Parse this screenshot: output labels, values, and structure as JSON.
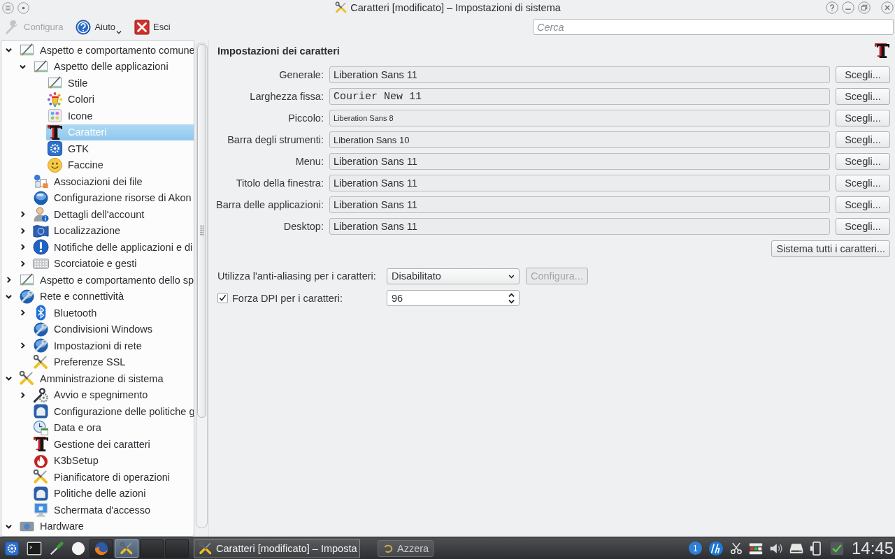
{
  "window": {
    "title": "Caratteri [modificato] – Impostazioni di sistema"
  },
  "toolbar": {
    "buttons": [
      {
        "label": "Configura",
        "kind": "configure",
        "disabled": true
      },
      {
        "label": "Aiuto",
        "kind": "help",
        "disabled": false
      },
      {
        "label": "Esci",
        "kind": "quit",
        "disabled": false
      }
    ]
  },
  "search": {
    "placeholder": "Cerca"
  },
  "sidebar": {
    "items": [
      {
        "label": "Aspetto e comportamento comune",
        "expanded": true,
        "selected": false,
        "children": [
          {
            "label": "Aspetto delle applicazioni",
            "expanded": true,
            "selected": false,
            "children": [
              {
                "label": "Stile",
                "selected": false
              },
              {
                "label": "Colori",
                "selected": false
              },
              {
                "label": "Icone",
                "selected": false
              },
              {
                "label": "Caratteri",
                "selected": true
              },
              {
                "label": "GTK",
                "selected": false
              },
              {
                "label": "Faccine",
                "selected": false
              }
            ]
          },
          {
            "label": "Associazioni dei file",
            "selected": false
          },
          {
            "label": "Configurazione risorse di Akon",
            "selected": false
          },
          {
            "label": "Dettagli dell'account",
            "expanded": false,
            "selected": false
          },
          {
            "label": "Localizzazione",
            "expanded": false,
            "selected": false
          },
          {
            "label": "Notifiche delle applicazioni e di",
            "expanded": false,
            "selected": false
          },
          {
            "label": "Scorciatoie e gesti",
            "expanded": false,
            "selected": false
          }
        ]
      },
      {
        "label": "Aspetto e comportamento dello sp",
        "expanded": false,
        "selected": false
      },
      {
        "label": "Rete e connettività",
        "expanded": true,
        "selected": false,
        "children": [
          {
            "label": "Bluetooth",
            "expanded": false,
            "selected": false
          },
          {
            "label": "Condivisioni Windows",
            "selected": false
          },
          {
            "label": "Impostazioni di rete",
            "expanded": false,
            "selected": false
          },
          {
            "label": "Preferenze SSL",
            "selected": false
          }
        ]
      },
      {
        "label": "Amministrazione di sistema",
        "expanded": true,
        "selected": false,
        "children": [
          {
            "label": "Avvio e spegnimento",
            "expanded": false,
            "selected": false
          },
          {
            "label": "Configurazione delle politiche g",
            "selected": false
          },
          {
            "label": "Data e ora",
            "selected": false
          },
          {
            "label": "Gestione dei caratteri",
            "selected": false
          },
          {
            "label": "K3bSetup",
            "selected": false
          },
          {
            "label": "Pianificatore di operazioni",
            "selected": false
          },
          {
            "label": "Politiche delle azioni",
            "selected": false
          },
          {
            "label": "Schermata d'accesso",
            "selected": false
          }
        ]
      },
      {
        "label": "Hardware",
        "expanded": true,
        "selected": false
      }
    ]
  },
  "panel": {
    "title": "Impostazioni dei caratteri",
    "fonts": [
      {
        "label": "Generale:",
        "value": "Liberation Sans 11",
        "button": "Scegli...",
        "kind": "regular"
      },
      {
        "label": "Larghezza fissa:",
        "value": "Courier New 11",
        "button": "Scegli...",
        "kind": "mono"
      },
      {
        "label": "Piccolo:",
        "value": "Liberation Sans 8",
        "button": "Scegli...",
        "kind": "small"
      },
      {
        "label": "Barra degli strumenti:",
        "value": "Liberation Sans 10",
        "button": "Scegli...",
        "kind": "medium"
      },
      {
        "label": "Menu:",
        "value": "Liberation Sans 11",
        "button": "Scegli...",
        "kind": "regular"
      },
      {
        "label": "Titolo della finestra:",
        "value": "Liberation Sans 11",
        "button": "Scegli...",
        "kind": "regular"
      },
      {
        "label": "Barra delle applicazioni:",
        "value": "Liberation Sans 11",
        "button": "Scegli...",
        "kind": "regular"
      },
      {
        "label": "Desktop:",
        "value": "Liberation Sans 11",
        "button": "Scegli...",
        "kind": "regular"
      }
    ],
    "adjust_all_button": "Sistema tutti i caratteri...",
    "antialiasing": {
      "label": "Utilizza l'anti-aliasing per i caratteri:",
      "value": "Disabilitato",
      "button": "Configura...",
      "button_disabled": true
    },
    "force_dpi": {
      "label": "Forza DPI per i caratteri:",
      "checked": true,
      "value": "96"
    }
  },
  "window_buttons": [
    {
      "label": "Azzera"
    }
  ],
  "taskbar": {
    "windows": [
      {
        "selected": false
      },
      {
        "selected": true
      },
      {
        "selected": false
      },
      {
        "selected": false
      }
    ],
    "task": "Caratteri [modificato] – Imposta",
    "badge": "1",
    "clock": "14:45"
  }
}
